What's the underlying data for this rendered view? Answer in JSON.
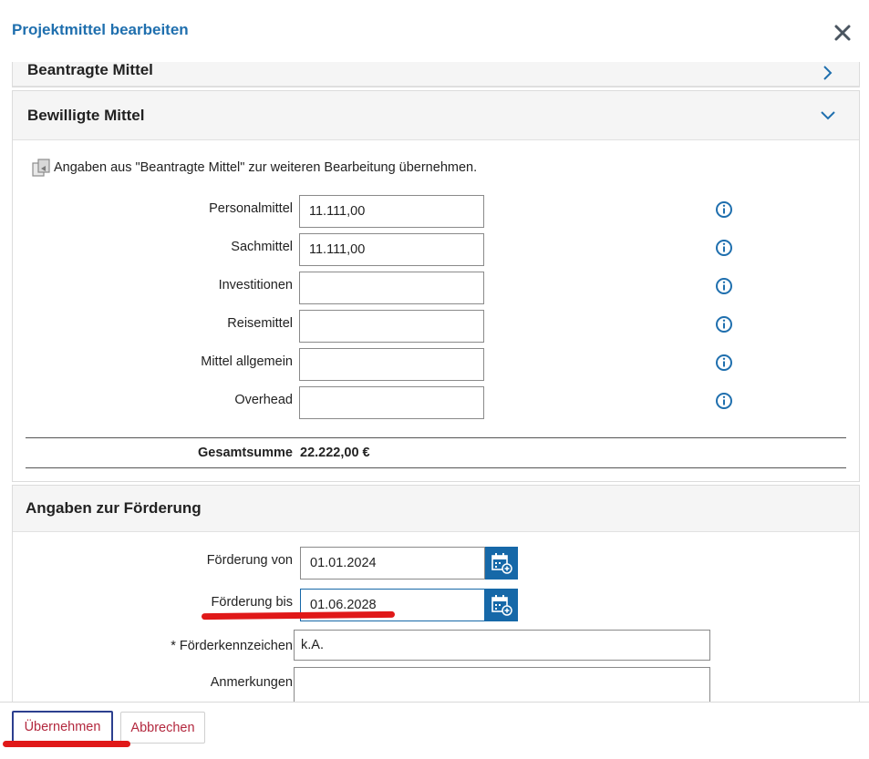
{
  "dialog": {
    "title": "Projektmittel bearbeiten",
    "close_icon": "close-icon"
  },
  "section_requested": {
    "title": "Beantragte Mittel",
    "icon": "chevron-right-icon"
  },
  "section_granted": {
    "title": "Bewilligte Mittel",
    "icon": "chevron-down-icon",
    "copy_hint": "Angaben aus \"Beantragte Mittel\" zur weiteren Bearbeitung übernehmen.",
    "copy_icon": "copy-icon",
    "fields": [
      {
        "label": "Personalmittel",
        "value": "11.111,00"
      },
      {
        "label": "Sachmittel",
        "value": "11.111,00"
      },
      {
        "label": "Investitionen",
        "value": ""
      },
      {
        "label": "Reisemittel",
        "value": ""
      },
      {
        "label": "Mittel allgemein",
        "value": ""
      },
      {
        "label": "Overhead",
        "value": ""
      }
    ],
    "total_label": "Gesamtsumme",
    "total_value": "22.222,00 €"
  },
  "section_funding": {
    "title": "Angaben zur Förderung",
    "from_label": "Förderung von",
    "from_value": "01.01.2024",
    "to_label": "Förderung bis",
    "to_value": "01.06.2028",
    "reference_label": "* Förderkennzeichen",
    "reference_value": "k.A.",
    "notes_label": "Anmerkungen",
    "notes_value": "",
    "calendar_icon": "calendar-icon"
  },
  "footer": {
    "apply_label": "Übernehmen",
    "cancel_label": "Abbrechen"
  },
  "colors": {
    "accent_blue": "#1f6fae",
    "calendar_blue": "#1668a8",
    "button_text": "#b3283e",
    "annotation_red": "#e01919"
  }
}
